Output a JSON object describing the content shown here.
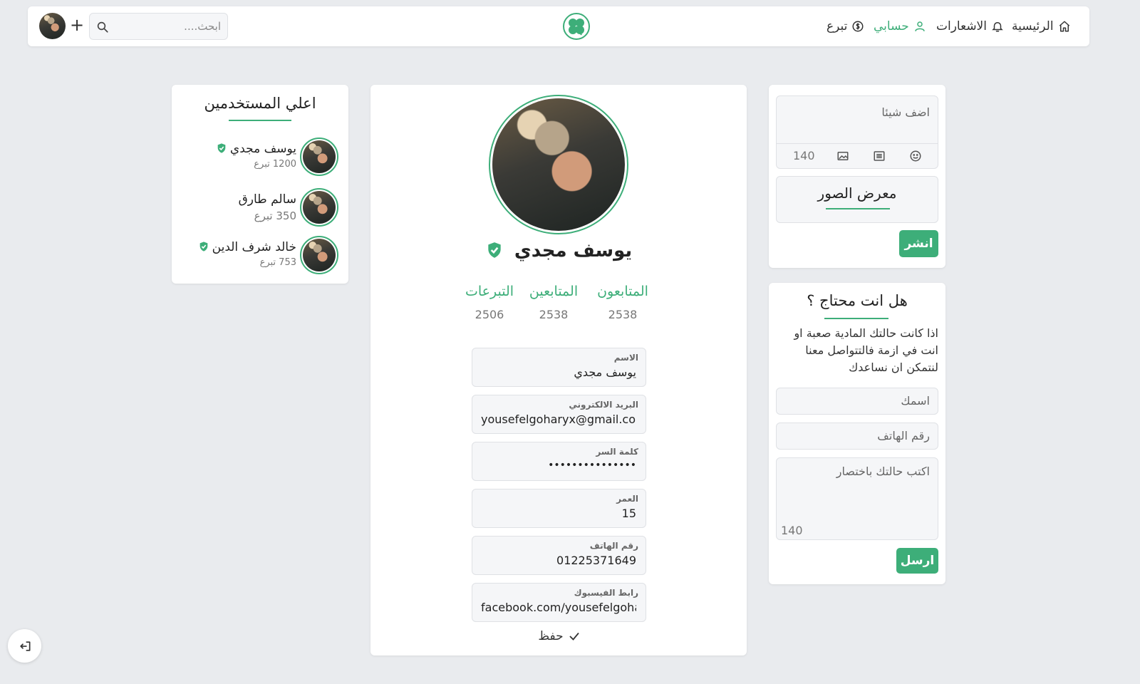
{
  "nav": {
    "home": "الرئيسية",
    "notifications": "الاشعارات",
    "account": "حسابي",
    "donate": "تبرع",
    "search_placeholder": "ابحث....",
    "plus": "+"
  },
  "colors": {
    "accent": "#3dae79",
    "background": "#e9ebee",
    "card": "#ffffff"
  },
  "top_users": {
    "title": "اعلي المستخدمين",
    "users": [
      {
        "name": "يوسف مجدي",
        "donations": "1200 تبرع",
        "verified": true
      },
      {
        "name": "سالم طارق",
        "donations": "350 تبرع",
        "verified": false
      },
      {
        "name": "خالد شرف الدين",
        "donations": "753 تبرع",
        "verified": true
      }
    ]
  },
  "profile": {
    "name": "يوسف مجدي",
    "verified": true,
    "stats": [
      {
        "label": "المتابعون",
        "value": "2538"
      },
      {
        "label": "المتابعين",
        "value": "2538"
      },
      {
        "label": "التبرعات",
        "value": "2506"
      }
    ],
    "fields": [
      {
        "label": "الاسم",
        "value": "يوسف مجدي"
      },
      {
        "label": "البريد الالكتروني",
        "value": "yousefelgoharyx@gmail.com"
      },
      {
        "label": "كلمة السر",
        "value": "•••••••••••••••"
      },
      {
        "label": "العمر",
        "value": "15"
      },
      {
        "label": "رقم الهاتف",
        "value": "01225371649"
      },
      {
        "label": "رابط الفيسبوك",
        "value": "facebook.com/yousefelgoharyx"
      }
    ],
    "save_label": "حفظ"
  },
  "composer": {
    "placeholder": "اضف شيئا",
    "counter": "140",
    "gallery_title": "معرض الصور",
    "publish_label": "انشر"
  },
  "help": {
    "title": "هل انت محتاج ؟",
    "description": "اذا كانت حالتك المادية صعبة او انت في ازمة فالتتواصل معنا لنتمكن ان نساعدك",
    "name_placeholder": "اسمك",
    "phone_placeholder": "رقم الهاتف",
    "message_placeholder": "اكتب حالتك باختصار",
    "counter": "140",
    "send_label": "ارسل"
  },
  "icons": {
    "home": "home-icon",
    "bell": "bell-icon",
    "user": "user-icon",
    "dollar": "dollar-icon",
    "search": "search-icon",
    "logo": "clover-logo-icon",
    "verified": "verified-badge-icon",
    "image": "image-icon",
    "list": "list-icon",
    "emoji": "emoji-icon",
    "check": "check-icon",
    "logout": "logout-icon"
  }
}
